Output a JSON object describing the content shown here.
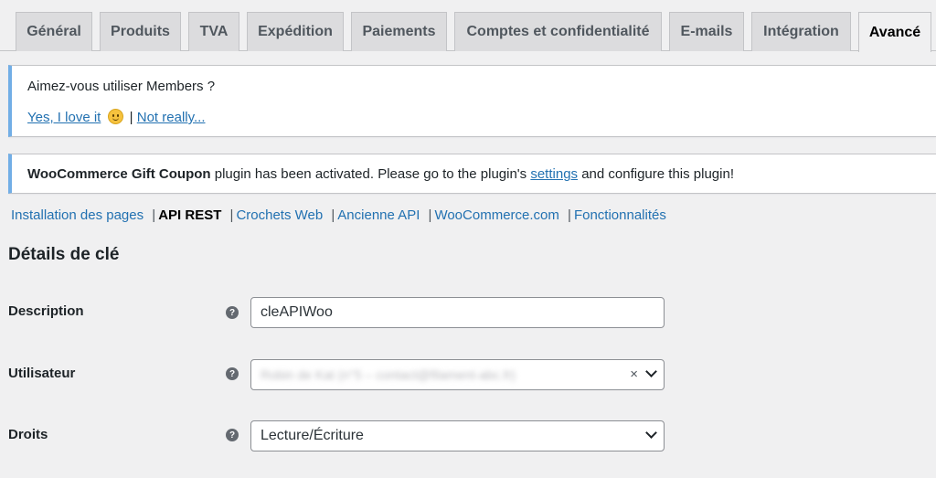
{
  "tabs": [
    {
      "label": "Général"
    },
    {
      "label": "Produits"
    },
    {
      "label": "TVA"
    },
    {
      "label": "Expédition"
    },
    {
      "label": "Paiements"
    },
    {
      "label": "Comptes et confidentialité"
    },
    {
      "label": "E-mails"
    },
    {
      "label": "Intégration"
    },
    {
      "label": "Avancé"
    }
  ],
  "notice_members": {
    "question": "Aimez-vous utiliser Members ?",
    "yes_link": "Yes, I love it",
    "separator": "|",
    "no_link": "Not really..."
  },
  "notice_gift": {
    "plugin_name": "WooCommerce Gift Coupon",
    "text_before": " plugin has been activated. Please go to the plugin's ",
    "settings_link": "settings",
    "text_after": " and configure this plugin!"
  },
  "subnav": {
    "items": [
      {
        "label": "Installation des pages"
      },
      {
        "label": "API REST"
      },
      {
        "label": "Crochets Web"
      },
      {
        "label": "Ancienne API"
      },
      {
        "label": "WooCommerce.com"
      },
      {
        "label": "Fonctionnalités"
      }
    ],
    "separator": "|"
  },
  "section_title": "Détails de clé",
  "form": {
    "description": {
      "label": "Description",
      "value": "cleAPIWoo"
    },
    "user": {
      "label": "Utilisateur",
      "value": "Robin de Kat (n°5 – contact@filament-abc.fr)",
      "clear": "×"
    },
    "permissions": {
      "label": "Droits",
      "value": "Lecture/Écriture"
    },
    "help_glyph": "?"
  },
  "colors": {
    "link": "#2271b1",
    "notice_border": "#72aee6",
    "background": "#f0f0f1"
  }
}
